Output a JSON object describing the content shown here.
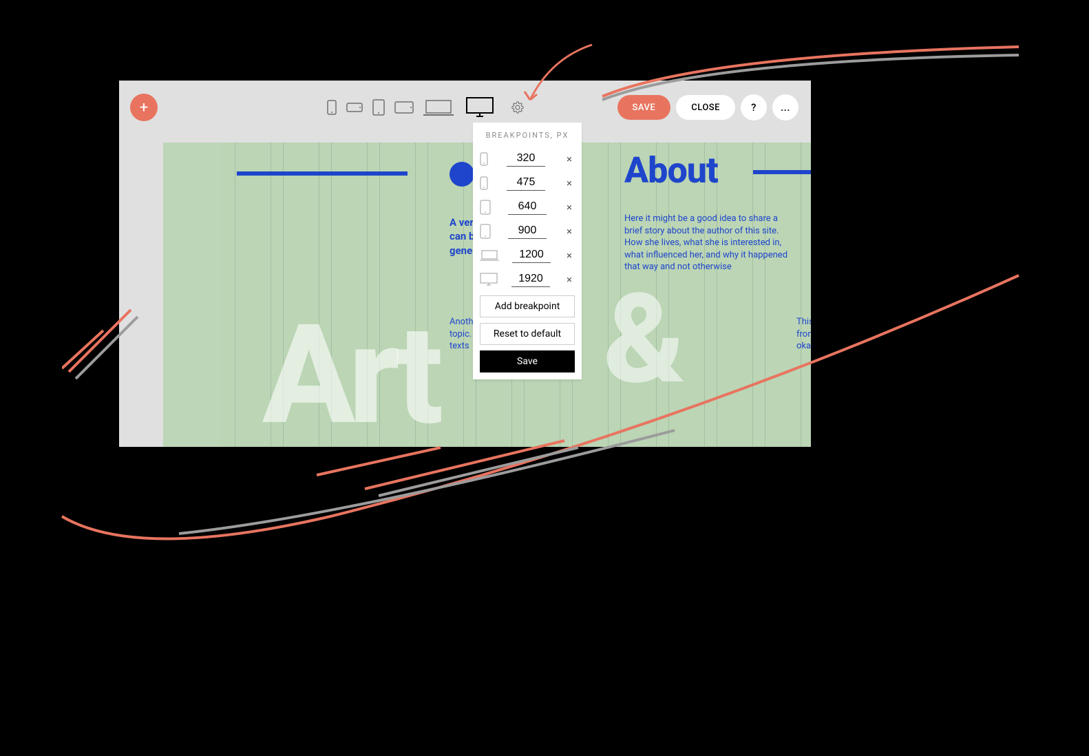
{
  "toolbar": {
    "save_label": "SAVE",
    "close_label": "CLOSE",
    "help_label": "?",
    "more_label": "..."
  },
  "breakpoints": {
    "title": "BREAKPOINTS, PX",
    "rows": [
      {
        "value": "320"
      },
      {
        "value": "475"
      },
      {
        "value": "640"
      },
      {
        "value": "900"
      },
      {
        "value": "1200"
      },
      {
        "value": "1920"
      }
    ],
    "add_label": "Add breakpoint",
    "reset_label": "Reset to default",
    "save_label": "Save"
  },
  "page": {
    "about_heading": "About",
    "intro_bold": "A very i\ncan be t\ngeneral",
    "about_copy": "Here it might be a good idea to share a brief story about the author of this site. How she lives, what she is interested in, what influenced her, and why it happened that way and not otherwise",
    "para3": "Another par\ntopic. Peop\ntexts",
    "para4": "This text b\nfrom the o\nokay and",
    "big_art": "Art",
    "big_amp": "&"
  }
}
